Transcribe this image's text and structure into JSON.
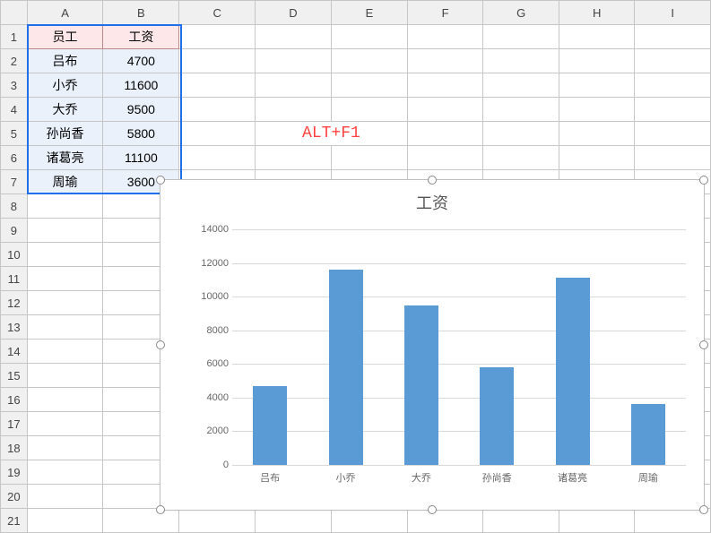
{
  "columns": [
    "A",
    "B",
    "C",
    "D",
    "E",
    "F",
    "G",
    "H",
    "I"
  ],
  "rows": [
    "1",
    "2",
    "3",
    "4",
    "5",
    "6",
    "7",
    "8",
    "9",
    "10",
    "11",
    "12",
    "13",
    "14",
    "15",
    "16",
    "17",
    "18",
    "19",
    "20",
    "21"
  ],
  "sheet": {
    "A1": "员工",
    "B1": "工资",
    "A2": "吕布",
    "B2": "4700",
    "A3": "小乔",
    "B3": "11600",
    "A4": "大乔",
    "B4": "9500",
    "A5": "孙尚香",
    "B5": "5800",
    "A6": "诸葛亮",
    "B6": "11100",
    "A7": "周瑜",
    "B7": "3600"
  },
  "annotation": "ALT+F1",
  "chart_data": {
    "type": "bar",
    "title": "工资",
    "categories": [
      "吕布",
      "小乔",
      "大乔",
      "孙尚香",
      "诸葛亮",
      "周瑜"
    ],
    "values": [
      4700,
      11600,
      9500,
      5800,
      11100,
      3600
    ],
    "ylim": [
      0,
      14000
    ],
    "yticks": [
      0,
      2000,
      4000,
      6000,
      8000,
      10000,
      12000,
      14000
    ],
    "xlabel": "",
    "ylabel": ""
  }
}
